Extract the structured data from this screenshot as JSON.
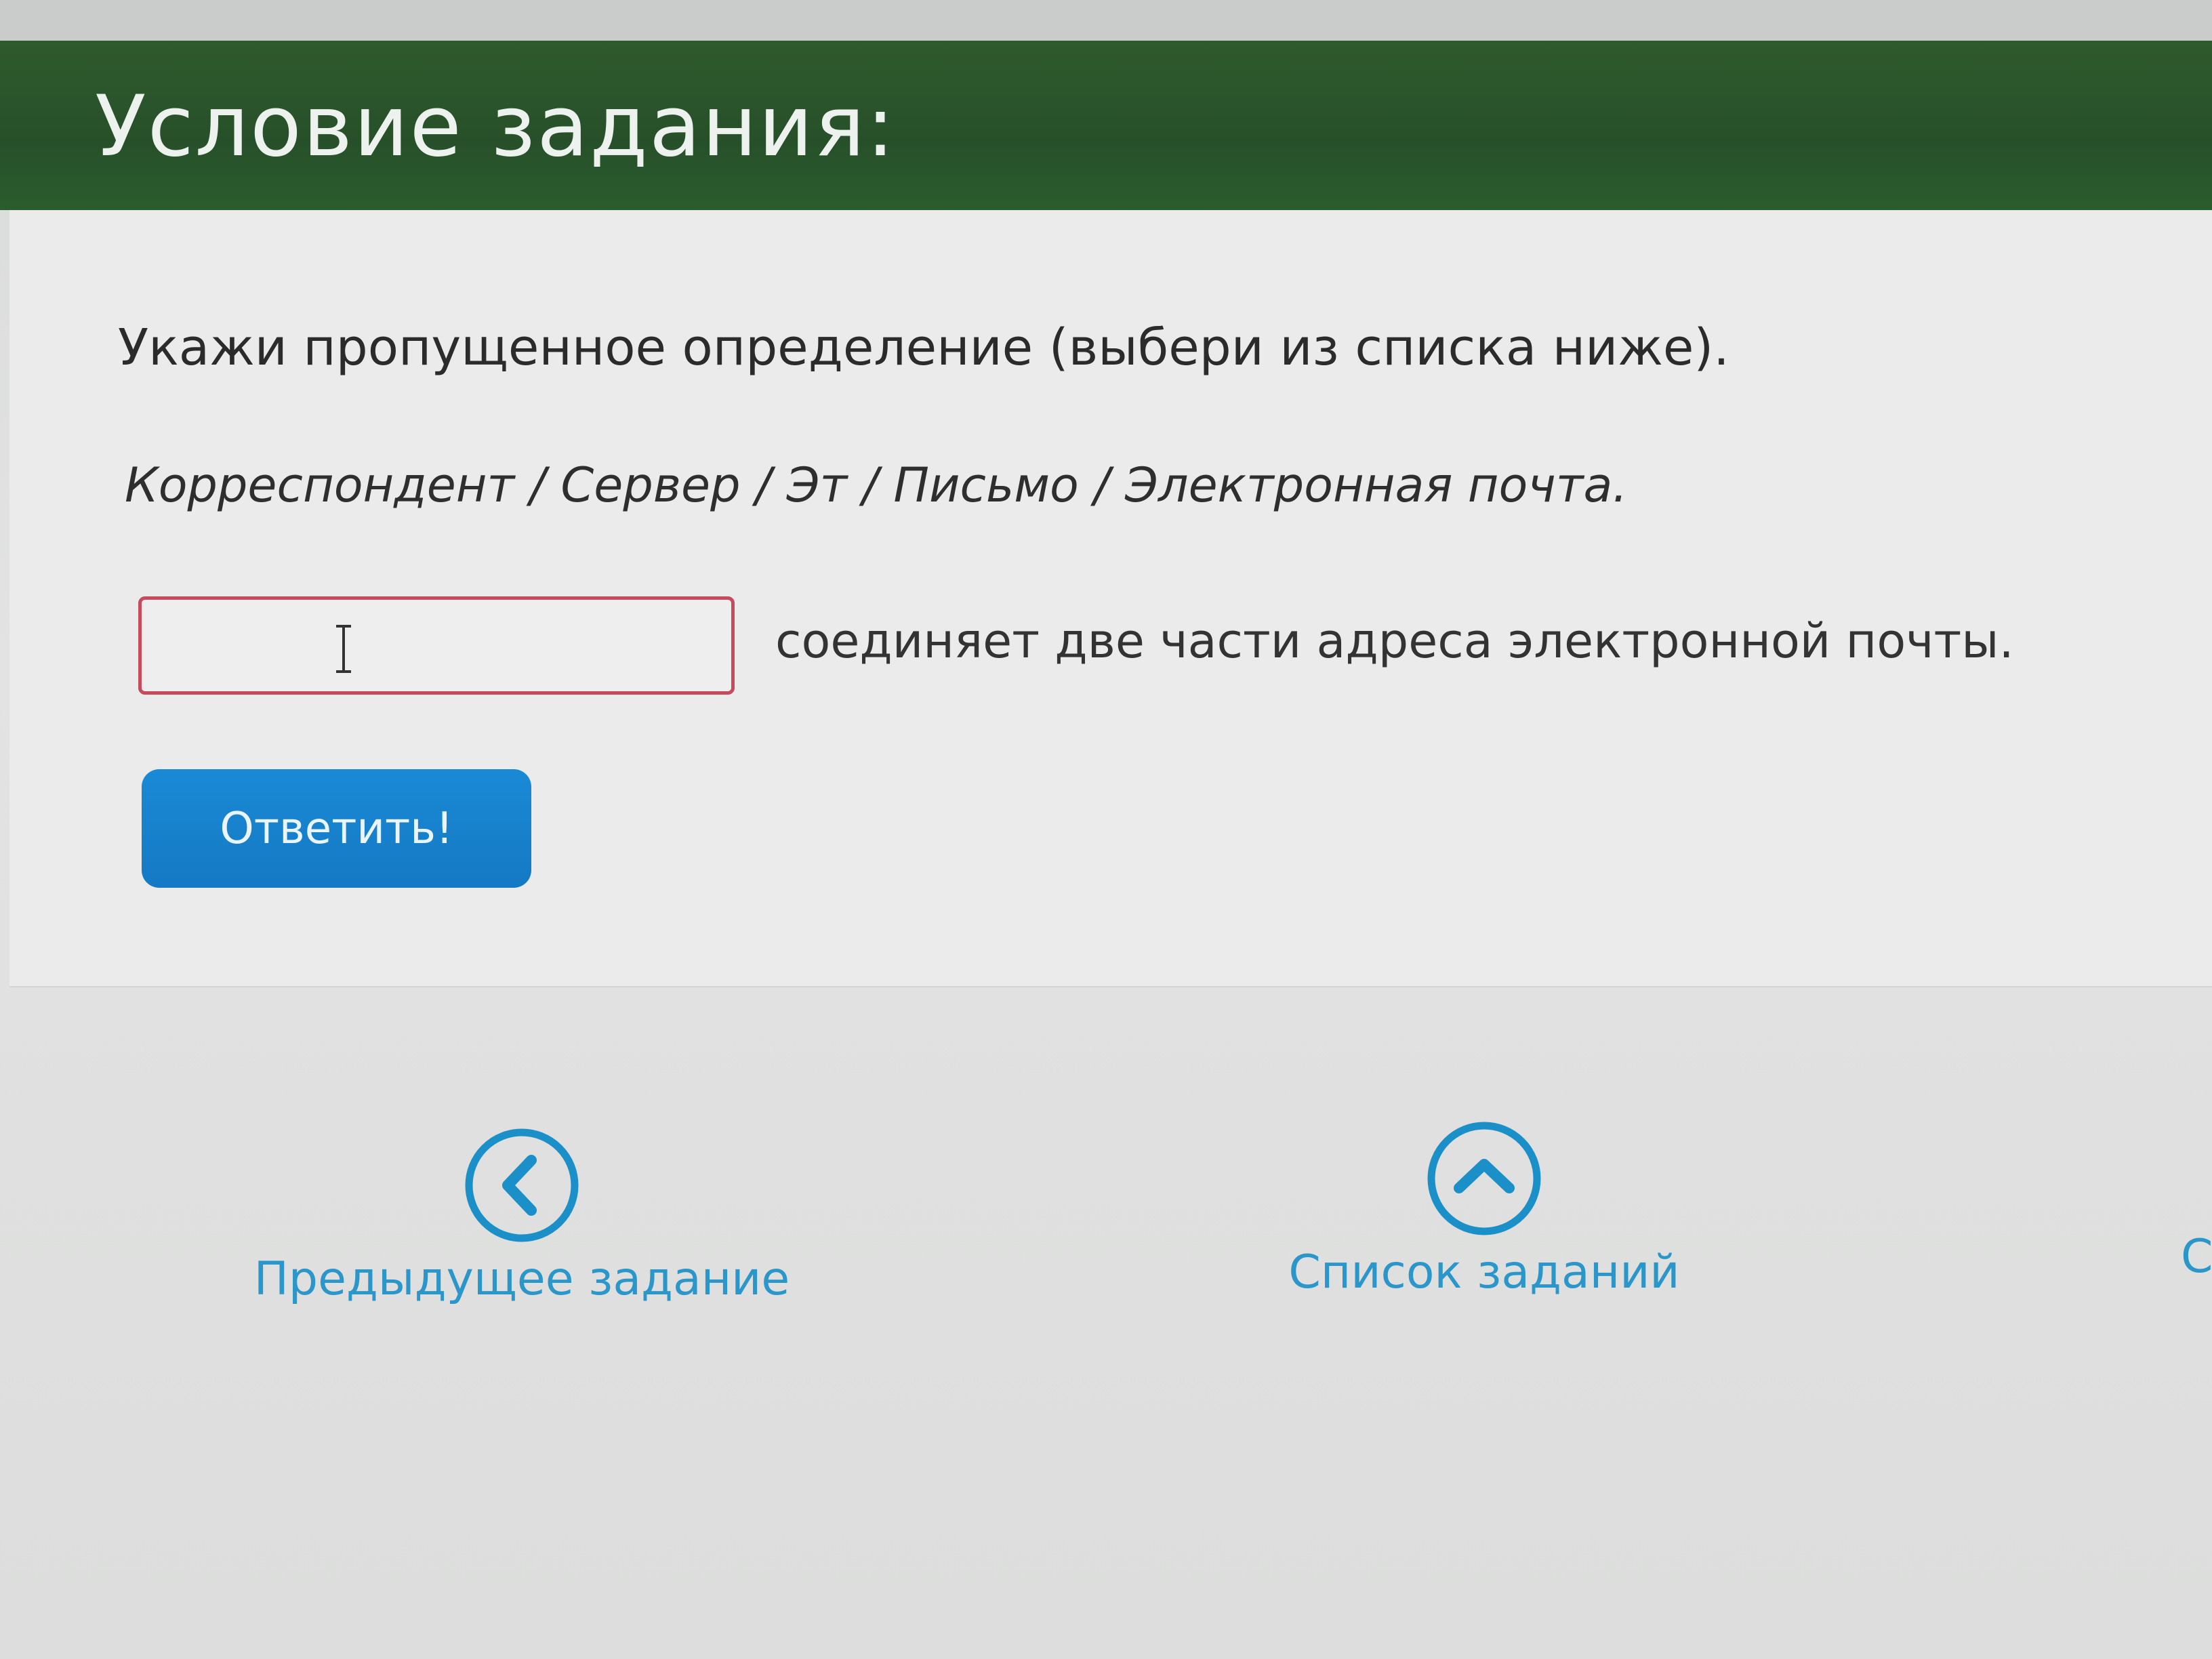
{
  "header": {
    "title": "Условие задания:"
  },
  "task": {
    "instruction": "Укажи пропущенное определение (выбери из списка ниже).",
    "options_text": "Корреспондент / Сервер / Эт / Письмо / Электронная почта.",
    "answer_value": "",
    "sentence": "соединяет две части адреса электронной почты.",
    "submit_label": "Ответить!"
  },
  "navigation": {
    "prev_label": "Предыдущее задание",
    "list_label": "Список заданий",
    "next_label_fragment": "С"
  },
  "colors": {
    "header_bg": "#2a552b",
    "button_bg": "#1a84d0",
    "link": "#2a96c9",
    "input_border": "#c44a5c"
  },
  "icons": {
    "prev": "chevron-left-circle-icon",
    "list": "chevron-up-circle-icon",
    "cursor": "text-cursor-icon"
  }
}
